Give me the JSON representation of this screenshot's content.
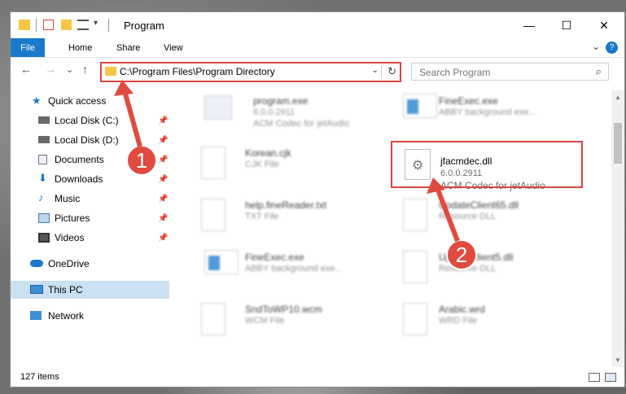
{
  "window": {
    "title": "Program",
    "minimize_glyph": "—",
    "maximize_glyph": "☐",
    "close_glyph": "✕"
  },
  "ribbon": {
    "tabs": [
      "File",
      "Home",
      "Share",
      "View"
    ],
    "help_glyph": "?",
    "collapse_glyph": "⌄"
  },
  "nav": {
    "back_glyph": "←",
    "forward_glyph": "→",
    "recent_glyph": "⌄",
    "up_glyph": "↑"
  },
  "address": {
    "path": "C:\\Program Files\\Program Directory",
    "dropdown_glyph": "⌄",
    "refresh_glyph": "↻"
  },
  "search": {
    "placeholder": "Search Program",
    "icon_glyph": "⌕"
  },
  "sidebar": {
    "items": [
      {
        "label": "Quick access",
        "icon": "star-icon",
        "pinned": false
      },
      {
        "label": "Local Disk (C:)",
        "icon": "drive-icon",
        "pinned": true
      },
      {
        "label": "Local Disk (D:)",
        "icon": "drive-icon",
        "pinned": true
      },
      {
        "label": "Documents",
        "icon": "documents-icon",
        "pinned": true
      },
      {
        "label": "Downloads",
        "icon": "download-icon",
        "pinned": true
      },
      {
        "label": "Music",
        "icon": "music-icon",
        "pinned": true
      },
      {
        "label": "Pictures",
        "icon": "pictures-icon",
        "pinned": true
      },
      {
        "label": "Videos",
        "icon": "videos-icon",
        "pinned": true
      },
      {
        "label": "OneDrive",
        "icon": "cloud-icon",
        "pinned": false
      },
      {
        "label": "This PC",
        "icon": "computer-icon",
        "pinned": false,
        "selected": true
      },
      {
        "label": "Network",
        "icon": "network-icon",
        "pinned": false
      }
    ],
    "pin_glyph": "📌"
  },
  "files": [
    {
      "name": "program.exe",
      "line2": "6.0.0.2911",
      "line3": "ACM Codec for jetAudio",
      "blurred": true
    },
    {
      "name": "FineExec.exe",
      "line2": "ABBY background exe...",
      "line3": "",
      "blurred": true
    },
    {
      "name": "Korean.cjk",
      "line2": "CJK File",
      "line3": "",
      "blurred": true
    },
    {
      "name": "jfacmdec.dll",
      "line2": "6.0.0.2911",
      "line3": "ACM Codec for jetAudio",
      "blurred": false
    },
    {
      "name": "help.fineReader.txt",
      "line2": "TXT File",
      "line3": "",
      "blurred": true
    },
    {
      "name": "UpdateClient65.dll",
      "line2": "Resource DLL",
      "line3": "",
      "blurred": true
    },
    {
      "name": "FineExec.exe",
      "line2": "ABBY background exe...",
      "line3": "",
      "blurred": true
    },
    {
      "name": "UpdateClient5.dll",
      "line2": "Resource DLL",
      "line3": "",
      "blurred": true
    },
    {
      "name": "SndToWP10.wcm",
      "line2": "WCM File",
      "line3": "",
      "blurred": true
    },
    {
      "name": "Arabic.wrd",
      "line2": "WRD File",
      "line3": "",
      "blurred": true
    }
  ],
  "status": {
    "item_count": "127 items"
  },
  "annotations": {
    "step1": "1",
    "step2": "2"
  },
  "colors": {
    "accent": "#1979ca",
    "highlight": "#d9463f",
    "selected_bg": "#cce0f4"
  }
}
